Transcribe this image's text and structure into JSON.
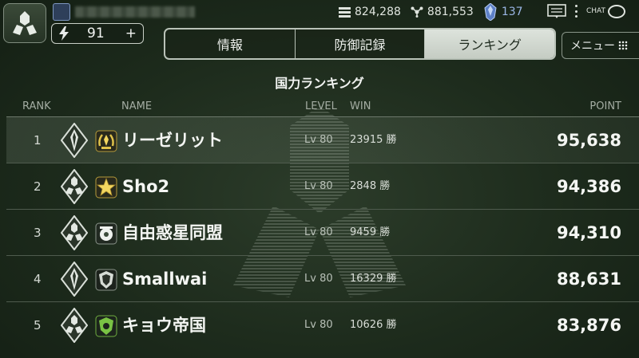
{
  "header": {
    "stamina_value": "91",
    "stamina_plus": "+",
    "resources": [
      {
        "icon": "stack-icon",
        "value": "824,288"
      },
      {
        "icon": "molecule-icon",
        "value": "881,553"
      },
      {
        "icon": "crystal-icon",
        "value": "137"
      }
    ],
    "chat_label": "CHAT"
  },
  "tabs": [
    {
      "label": "情報",
      "active": false
    },
    {
      "label": "防御記録",
      "active": false
    },
    {
      "label": "ランキング",
      "active": true
    }
  ],
  "menu_label": "メニュー",
  "ranking_title": "国力ランキング",
  "columns": {
    "rank": "RANK",
    "name": "NAME",
    "level": "LEVEL",
    "win": "WIN",
    "point": "POINT"
  },
  "rows": [
    {
      "rank": "1",
      "emblem": "blade-emblem-icon",
      "badge": "gold-wreath-badge-icon",
      "name": "リーゼリット",
      "level": "Lv 80",
      "win": "23915 勝",
      "point": "95,638"
    },
    {
      "rank": "2",
      "emblem": "trefoil-emblem-icon",
      "badge": "gold-star-badge-icon",
      "name": "Sho2",
      "level": "Lv 80",
      "win": "2848 勝",
      "point": "94,386"
    },
    {
      "rank": "3",
      "emblem": "trefoil-emblem-icon",
      "badge": "white-gear-badge-icon",
      "name": "自由惑星同盟",
      "level": "Lv 80",
      "win": "9459 勝",
      "point": "94,310"
    },
    {
      "rank": "4",
      "emblem": "blade-emblem-icon",
      "badge": "dark-shield-badge-icon",
      "name": "Smallwai",
      "level": "Lv 80",
      "win": "16329 勝",
      "point": "88,631"
    },
    {
      "rank": "5",
      "emblem": "trefoil-emblem-icon",
      "badge": "green-shield-badge-icon",
      "name": "キョウ帝国",
      "level": "Lv 80",
      "win": "10626 勝",
      "point": "83,876"
    }
  ],
  "colors": {
    "accent": "#c5ccc3",
    "background": "#1c2a1b",
    "gem": "#9bb7e6"
  }
}
